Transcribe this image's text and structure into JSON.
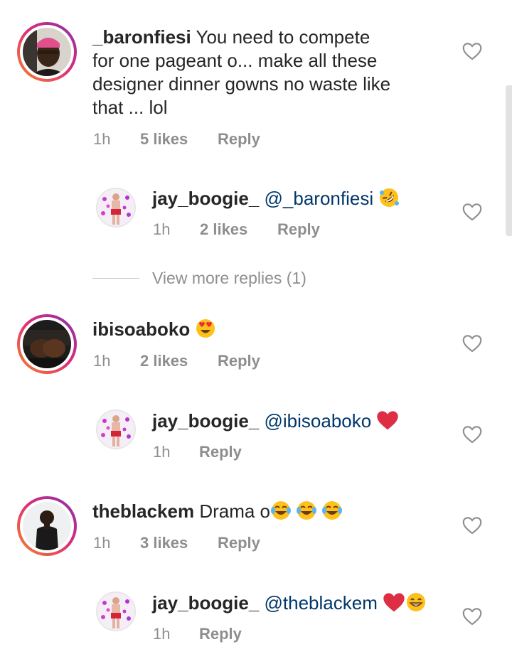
{
  "comments": [
    {
      "username": "_baronfiesi",
      "text_lines": [
        "You need to compete",
        "for one pageant o... make all these",
        "designer dinner gowns no waste like",
        "that ... lol"
      ],
      "time": "1h",
      "likes": "5 likes",
      "reply": "Reply"
    },
    {
      "username": "jay_boogie_",
      "mention": "@_baronfiesi",
      "emoji": "rofl-emoji",
      "time": "1h",
      "likes": "2 likes",
      "reply": "Reply"
    },
    {
      "username": "ibisoaboko",
      "emoji": "heart-eyes-emoji",
      "time": "1h",
      "likes": "2 likes",
      "reply": "Reply"
    },
    {
      "username": "jay_boogie_",
      "mention": "@ibisoaboko",
      "emoji": "red-heart-emoji",
      "time": "1h",
      "reply": "Reply"
    },
    {
      "username": "theblackem",
      "text": "Drama o",
      "emoji": "tears-of-joy-emoji",
      "time": "1h",
      "likes": "3 likes",
      "reply": "Reply"
    },
    {
      "username": "jay_boogie_",
      "mention": "@theblackem",
      "emoji": "red-heart-emoji grinning-emoji",
      "time": "1h",
      "reply": "Reply"
    }
  ],
  "view_more": "View more replies (1)",
  "colors": {
    "text": "#262626",
    "meta": "#8e8e8e",
    "mention": "#00376b",
    "ring_start": "#f58529",
    "ring_end": "#8134af",
    "heart": "#ed2b3a"
  }
}
